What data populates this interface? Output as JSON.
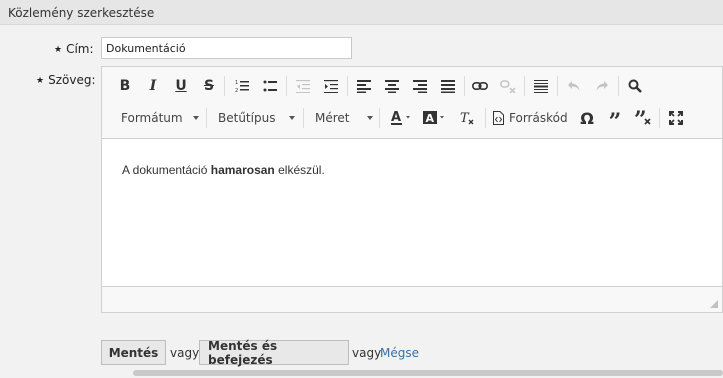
{
  "header": {
    "title": "Közlemény szerkesztése"
  },
  "form": {
    "title_label": "Cím:",
    "title_value": "Dokumentáció",
    "body_label": "Szöveg:",
    "required_mark": "★"
  },
  "toolbar": {
    "format_combo": "Formátum",
    "font_combo": "Betűtípus",
    "size_combo": "Méret",
    "source_label": "Forráskód",
    "icons": [
      "bold-icon",
      "italic-icon",
      "underline-icon",
      "strikethrough-icon",
      "numbered-list-icon",
      "bulleted-list-icon",
      "outdent-icon",
      "indent-icon",
      "align-left-icon",
      "align-center-icon",
      "align-right-icon",
      "justify-icon",
      "link-icon",
      "unlink-icon",
      "horizontal-rule-icon",
      "undo-icon",
      "redo-icon",
      "find-icon",
      "text-color-icon",
      "background-color-icon",
      "remove-format-icon",
      "source-icon",
      "special-char-icon",
      "blockquote-icon",
      "remove-blockquote-icon",
      "maximize-icon"
    ]
  },
  "editor": {
    "text_before": "A dokumentáció ",
    "text_bold": "hamarosan",
    "text_after": " elkészül."
  },
  "actions": {
    "save": "Mentés",
    "or1": "vagy",
    "save_finish": "Mentés és befejezés",
    "or2": "vagy",
    "cancel": "Mégse"
  }
}
